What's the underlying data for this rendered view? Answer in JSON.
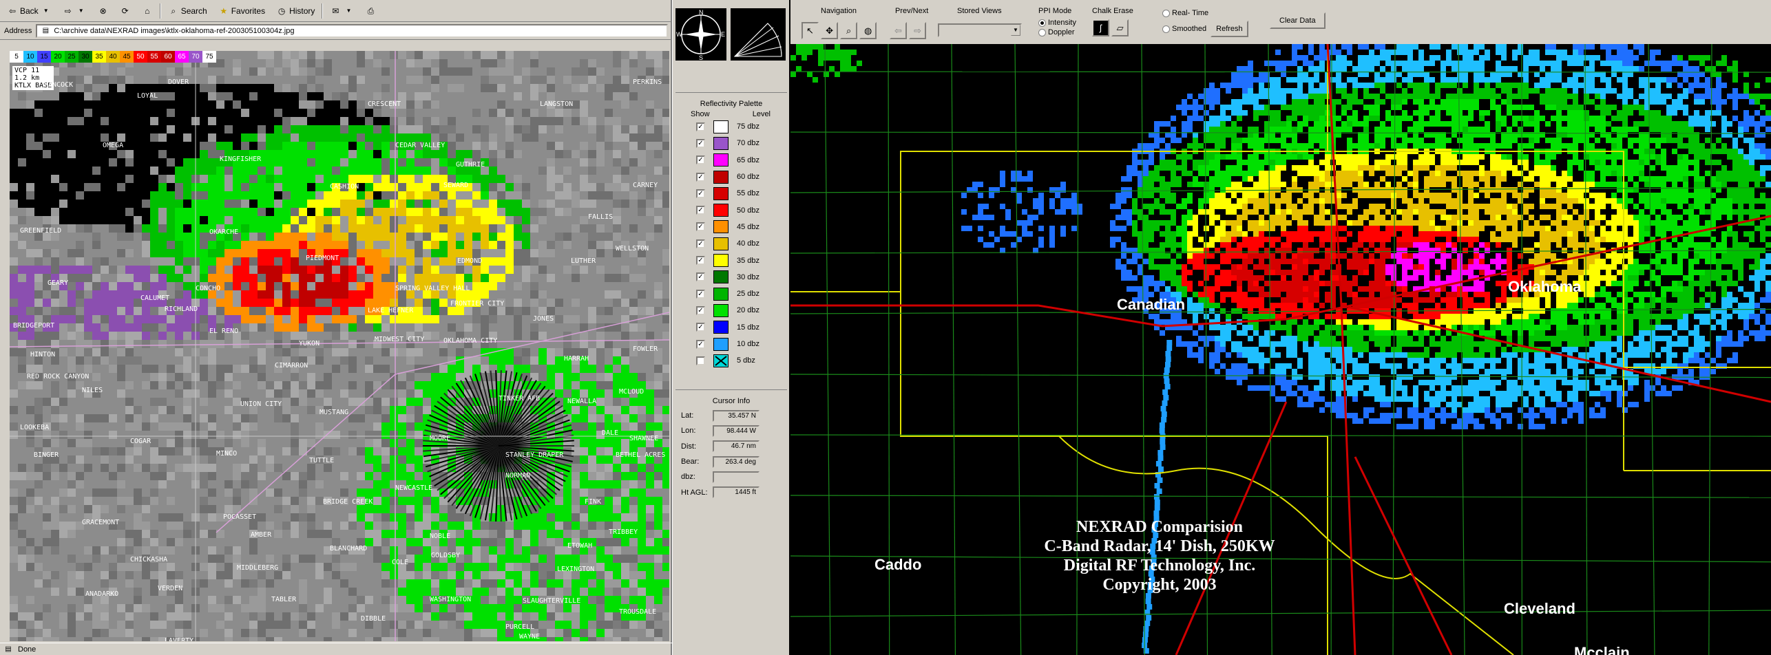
{
  "browser": {
    "toolbar": {
      "back": "Back",
      "forward": "",
      "search": "Search",
      "favorites": "Favorites",
      "history": "History"
    },
    "address": {
      "label": "Address",
      "value": "C:\\archive data\\NEXRAD images\\ktlx-oklahoma-ref-200305100304z.jpg"
    },
    "status": "Done",
    "radar_image": {
      "scale": [
        "5",
        "10",
        "15",
        "20",
        "25",
        "30",
        "35",
        "40",
        "45",
        "50",
        "55",
        "60",
        "65",
        "70",
        "75"
      ],
      "scale_colors": [
        "#ffffff",
        "#1fbfff",
        "#4040ff",
        "#00e000",
        "#00b400",
        "#007800",
        "#ffff00",
        "#e7c000",
        "#ff9000",
        "#ff0000",
        "#d60000",
        "#c00000",
        "#ff00ff",
        "#9955c9",
        "#ffffff"
      ],
      "vcp": [
        "VCP 11",
        "1.2 km",
        "KTLX BASE"
      ],
      "towns": [
        "HANCOCK",
        "DOVER",
        "PERKINS",
        "LOYAL",
        "OMEGA",
        "KINGFISHER",
        "CRESCENT",
        "LANGSTON",
        "CEDAR VALLEY",
        "GUTHRIE",
        "CARNEY",
        "CASHION",
        "SEWARD",
        "FALLIS",
        "GREENFIELD",
        "OKARCHE",
        "WELLSTON",
        "PIEDMONT",
        "EDMOND",
        "LUTHER",
        "GEARY",
        "CALUMET",
        "CONCHO",
        "SPRING VALLEY HALL",
        "JONES",
        "RICHLAND",
        "FRONTIER CITY",
        "LAKE HEFNER",
        "BRIDGEPORT",
        "EL RENO",
        "YUKON",
        "OKLAHOMA CITY",
        "MIDWEST CITY",
        "CIMARRON",
        "HARRAH",
        "FOWLER",
        "HINTON",
        "RED ROCK CANYON",
        "NILES",
        "MCLOUD",
        "UNION CITY",
        "MUSTANG",
        "TINKER AFB",
        "NEWALLA",
        "LOOKEBA",
        "COGAR",
        "MOORE",
        "DALE",
        "SHAWNEE",
        "BINGER",
        "MINCO",
        "TUTTLE",
        "NORMAN",
        "BETHEL ACRES",
        "NEWCASTLE",
        "STANLEY DRAPER",
        "FINK",
        "GRACEMONT",
        "BRIDGE CREEK",
        "TRIBBEY",
        "POCASSET",
        "AMBER",
        "BLANCHARD",
        "NOBLE",
        "ETOWAH",
        "CHICKASHA",
        "COLE",
        "GOLDSBY",
        "LEXINGTON",
        "ANADARKO",
        "VERDEN",
        "MIDDLEBERG",
        "TABLER",
        "WASHINGTON",
        "PURCELL",
        "SLAUGHTERVILLE",
        "TROUSDALE",
        "LAVERTY",
        "DIBBLE",
        "WAYNE"
      ]
    }
  },
  "panel": {
    "palette_title": "Reflectivity Palette",
    "show_label": "Show",
    "level_label": "Level",
    "levels": [
      {
        "label": "75 dbz",
        "color": "#ffffff",
        "checked": "✓"
      },
      {
        "label": "70 dbz",
        "color": "#9955c9",
        "checked": "✓"
      },
      {
        "label": "65 dbz",
        "color": "#ff00ff",
        "checked": "✓"
      },
      {
        "label": "60 dbz",
        "color": "#c00000",
        "checked": "✓"
      },
      {
        "label": "55 dbz",
        "color": "#d60000",
        "checked": "✓"
      },
      {
        "label": "50 dbz",
        "color": "#ff0000",
        "checked": "✓"
      },
      {
        "label": "45 dbz",
        "color": "#ff9000",
        "checked": "✓"
      },
      {
        "label": "40 dbz",
        "color": "#e7c000",
        "checked": "✓"
      },
      {
        "label": "35 dbz",
        "color": "#ffff00",
        "checked": "✓"
      },
      {
        "label": "30 dbz",
        "color": "#007800",
        "checked": "✓"
      },
      {
        "label": "25 dbz",
        "color": "#00b400",
        "checked": "✓"
      },
      {
        "label": "20 dbz",
        "color": "#00e000",
        "checked": "✓"
      },
      {
        "label": "15 dbz",
        "color": "#0000ff",
        "checked": "✓"
      },
      {
        "label": "10 dbz",
        "color": "#1f9fff",
        "checked": "✓"
      },
      {
        "label": "5 dbz",
        "color": "#00d8d8",
        "checked": ""
      }
    ],
    "cursor_title": "Cursor Info",
    "cursor": [
      {
        "label": "Lat:",
        "value": "35.457 N"
      },
      {
        "label": "Lon:",
        "value": "98.444 W"
      },
      {
        "label": "Dist:",
        "value": "46.7 nm"
      },
      {
        "label": "Bear:",
        "value": "263.4 deg"
      },
      {
        "label": "dbz:",
        "value": ""
      },
      {
        "label": "Ht AGL:",
        "value": "1445 ft"
      }
    ]
  },
  "app": {
    "navigation_label": "Navigation",
    "prevnext_label": "Prev/Next",
    "stored_views_label": "Stored Views",
    "ppi_mode_label": "PPI Mode",
    "ppi_intensity": "Intensity",
    "ppi_doppler": "Doppler",
    "chalk_label": "Chalk Erase",
    "realtime_label": "Real- Time",
    "smoothed_label": "Smoothed",
    "refresh_label": "Refresh",
    "clear_label": "Clear Data",
    "map": {
      "counties": [
        "Canadian",
        "Oklahoma",
        "Caddo",
        "Cleveland",
        "Mcclain"
      ],
      "caption": [
        "NEXRAD Comparision",
        "C-Band Radar, 14' Dish, 250KW",
        "Digital RF Technology, Inc.",
        "Copyright, 2003"
      ]
    }
  }
}
